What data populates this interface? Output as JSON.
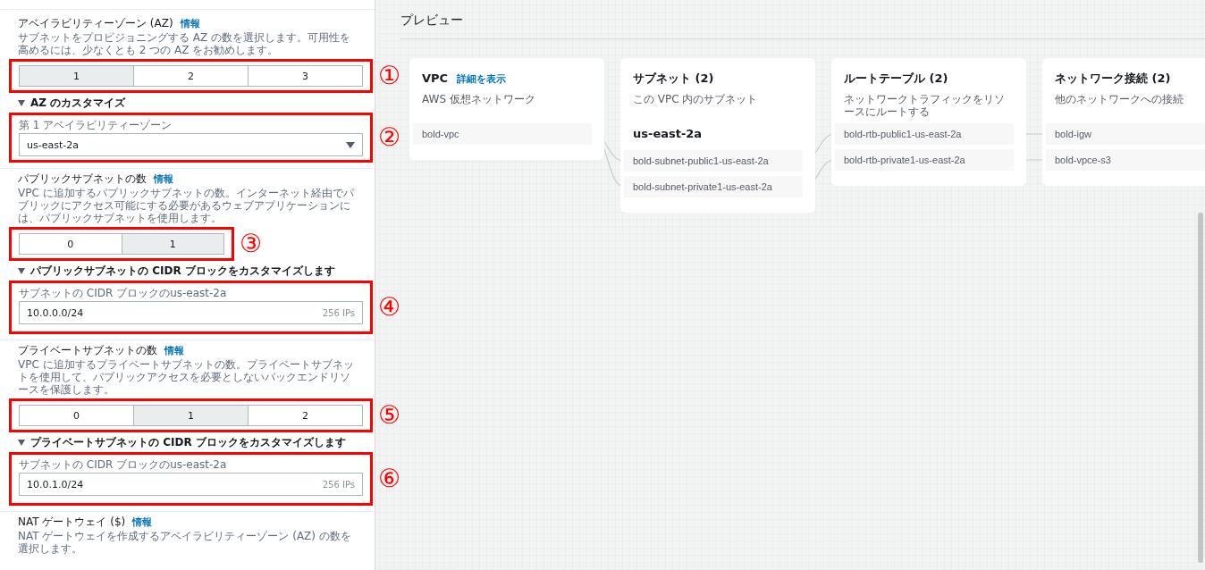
{
  "settings": {
    "sections": [
      {
        "title": "アベイラビリティーゾーン (AZ)",
        "info": "情報",
        "description": "サブネットをプロビジョニングする AZ の数を選択します。可用性を高めるには、少なくとも 2 つの AZ をお勧めします。",
        "control": {
          "kind": "segmented",
          "marker": "①",
          "options": [
            {
              "label": "1",
              "selected": true
            },
            {
              "label": "2",
              "selected": false
            },
            {
              "label": "3",
              "selected": false
            }
          ]
        },
        "expander": {
          "label": "AZ のカスタマイズ",
          "expanded": true,
          "field": {
            "kind": "select",
            "marker": "②",
            "label": "第 1 アベイラビリティーゾーン",
            "value": "us-east-2a"
          }
        }
      },
      {
        "title": "パブリックサブネットの数",
        "info": "情報",
        "description": "VPC に追加するパブリックサブネットの数。インターネット経由でパブリックにアクセス可能にする必要があるウェブアプリケーションには、パブリックサブネットを使用します。",
        "control": {
          "kind": "segmented",
          "marker": "③",
          "options": [
            {
              "label": "0",
              "selected": false
            },
            {
              "label": "1",
              "selected": true
            }
          ]
        },
        "expander": {
          "label": "パブリックサブネットの CIDR ブロックをカスタマイズします",
          "expanded": true,
          "field": {
            "kind": "cidr",
            "marker": "④",
            "label": "サブネットの CIDR ブロックのus-east-2a",
            "value": "10.0.0.0/24",
            "hint": "256 IPs"
          }
        }
      },
      {
        "title": "プライベートサブネットの数",
        "info": "情報",
        "description": "VPC に追加するプライベートサブネットの数。プライベートサブネットを使用して、パブリックアクセスを必要としないバックエンドリソースを保護します。",
        "control": {
          "kind": "segmented",
          "marker": "⑤",
          "options": [
            {
              "label": "0",
              "selected": false
            },
            {
              "label": "1",
              "selected": true
            },
            {
              "label": "2",
              "selected": false
            }
          ]
        },
        "expander": {
          "label": "プライベートサブネットの CIDR ブロックをカスタマイズします",
          "expanded": true,
          "field": {
            "kind": "cidr",
            "marker": "⑥",
            "label": "サブネットの CIDR ブロックのus-east-2a",
            "value": "10.0.1.0/24",
            "hint": "256 IPs"
          }
        }
      },
      {
        "title": "NAT ゲートウェイ ($)",
        "info": "情報",
        "description": "NAT ゲートウェイを作成するアベイラビリティーゾーン (AZ) の数を選択します。"
      }
    ]
  },
  "preview": {
    "title": "プレビュー",
    "cards": [
      {
        "title": "VPC",
        "link": "詳細を表示",
        "subtitle": "AWS 仮想ネットワーク",
        "groups": [
          {
            "items": [
              "bold-vpc"
            ]
          }
        ]
      },
      {
        "title": "サブネット (2)",
        "subtitle": "この VPC 内のサブネット",
        "groups": [
          {
            "heading": "us-east-2a",
            "items": [
              "bold-subnet-public1-us-east-2a",
              "bold-subnet-private1-us-east-2a"
            ]
          }
        ]
      },
      {
        "title": "ルートテーブル (2)",
        "subtitle": "ネットワークトラフィックをリソースにルートする",
        "groups": [
          {
            "items": [
              "bold-rtb-public1-us-east-2a",
              "bold-rtb-private1-us-east-2a"
            ]
          }
        ]
      },
      {
        "title": "ネットワーク接続 (2)",
        "subtitle": "他のネットワークへの接続",
        "groups": [
          {
            "items": [
              "bold-igw",
              "bold-vpce-s3"
            ]
          }
        ]
      }
    ]
  }
}
